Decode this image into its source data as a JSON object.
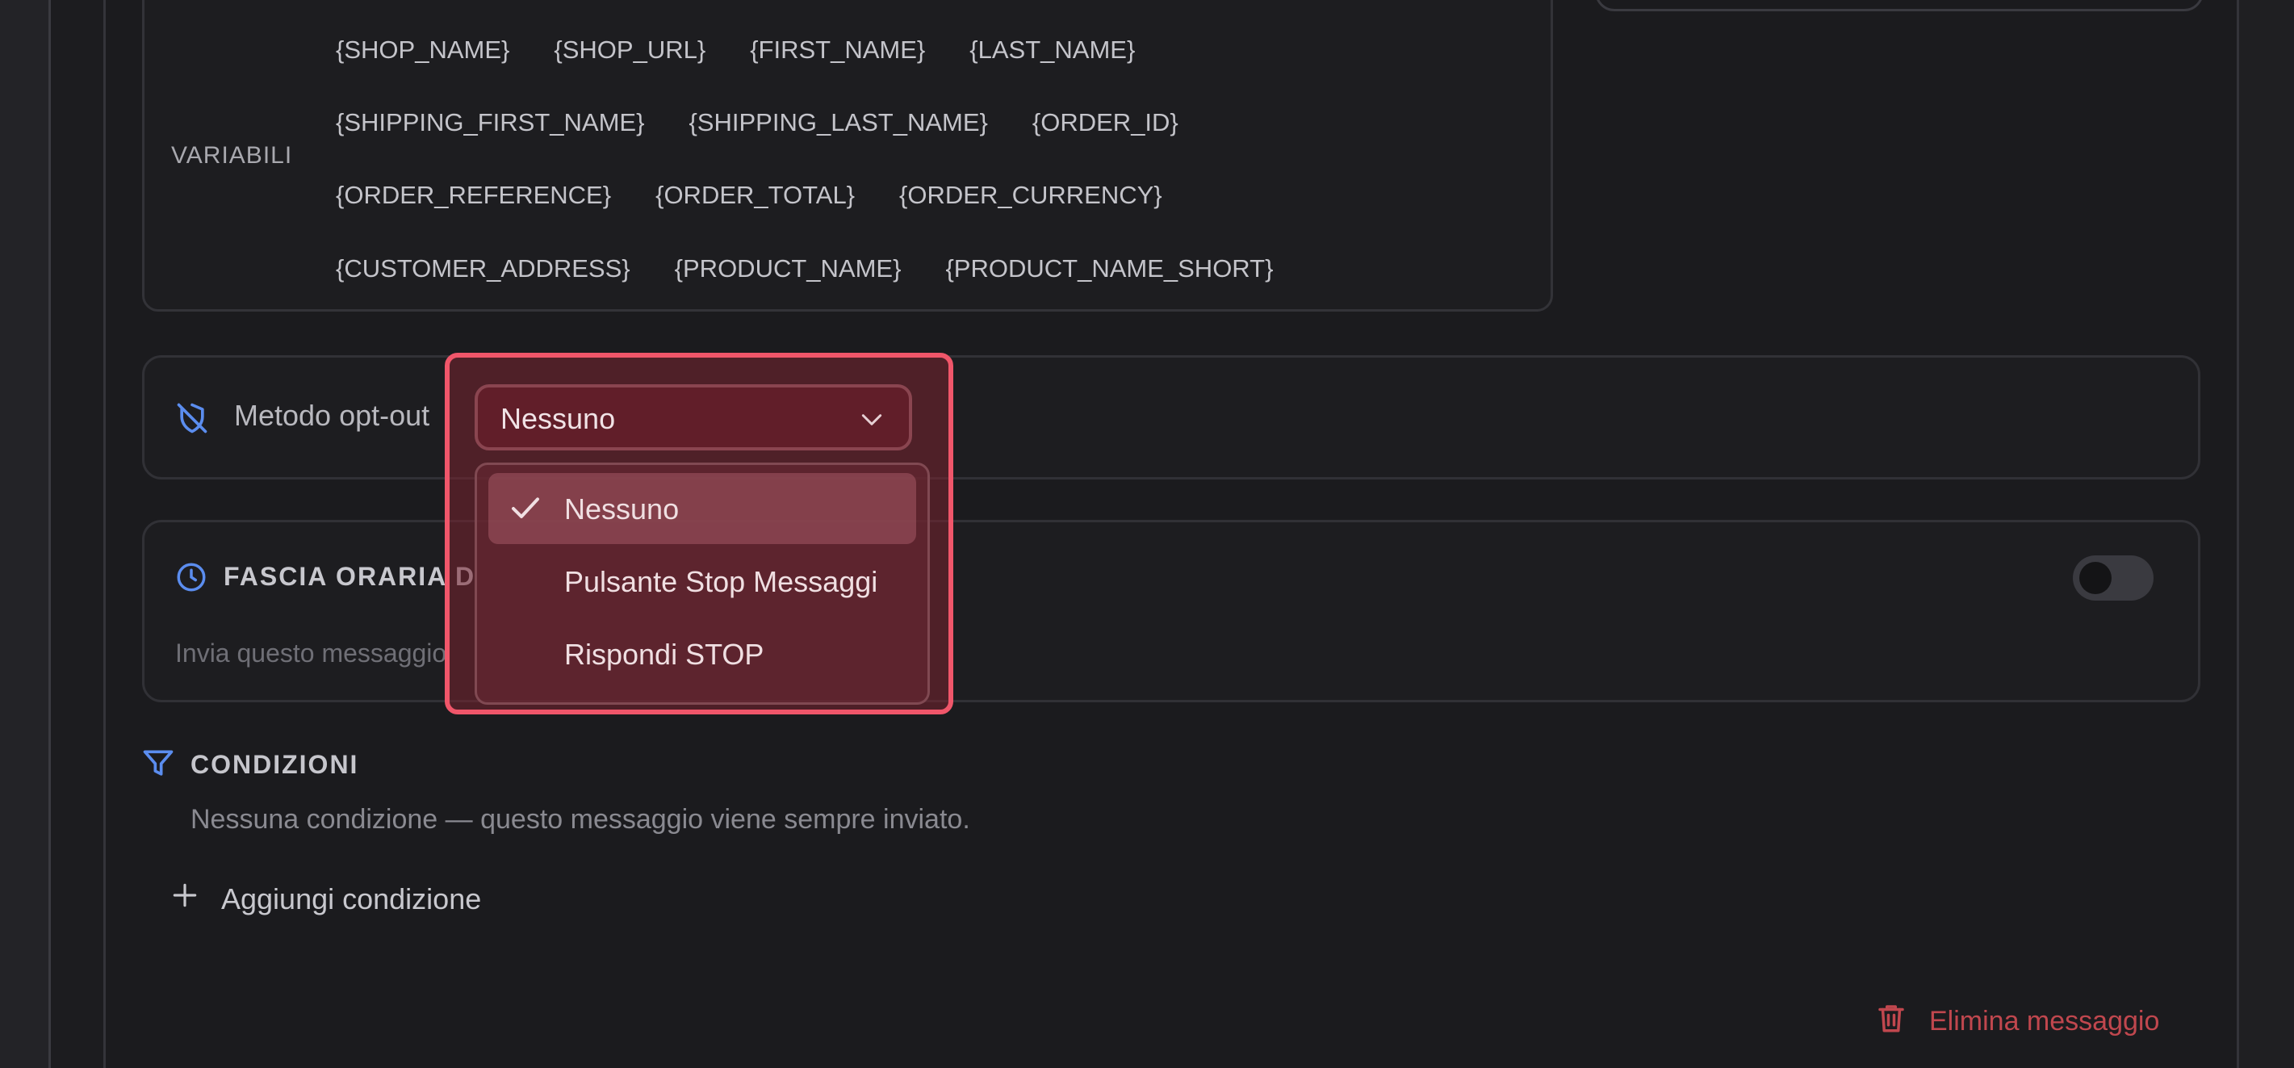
{
  "variables": {
    "label": "VARIABILI",
    "rows": [
      [
        "{SHOP_NAME}",
        "{SHOP_URL}",
        "{FIRST_NAME}",
        "{LAST_NAME}"
      ],
      [
        "{SHIPPING_FIRST_NAME}",
        "{SHIPPING_LAST_NAME}",
        "{ORDER_ID}"
      ],
      [
        "{ORDER_REFERENCE}",
        "{ORDER_TOTAL}",
        "{ORDER_CURRENCY}"
      ],
      [
        "{CUSTOMER_ADDRESS}",
        "{PRODUCT_NAME}",
        "{PRODUCT_NAME_SHORT}"
      ]
    ]
  },
  "optout": {
    "label": "Metodo opt-out",
    "selected": "Nessuno",
    "options": [
      "Nessuno",
      "Pulsante Stop Messaggi",
      "Rispondi STOP"
    ]
  },
  "fascia": {
    "title": "FASCIA ORARIA D",
    "description": "Invia questo messaggio",
    "enabled": false
  },
  "conditions": {
    "title": "CONDIZIONI",
    "empty_text": "Nessuna condizione — questo messaggio viene sempre inviato.",
    "add_label": "Aggiungi condizione"
  },
  "actions": {
    "delete_label": "Elimina messaggio"
  },
  "colors": {
    "accent_blue": "#5b8def",
    "highlight": "#f0566a",
    "danger": "#c0474e"
  }
}
